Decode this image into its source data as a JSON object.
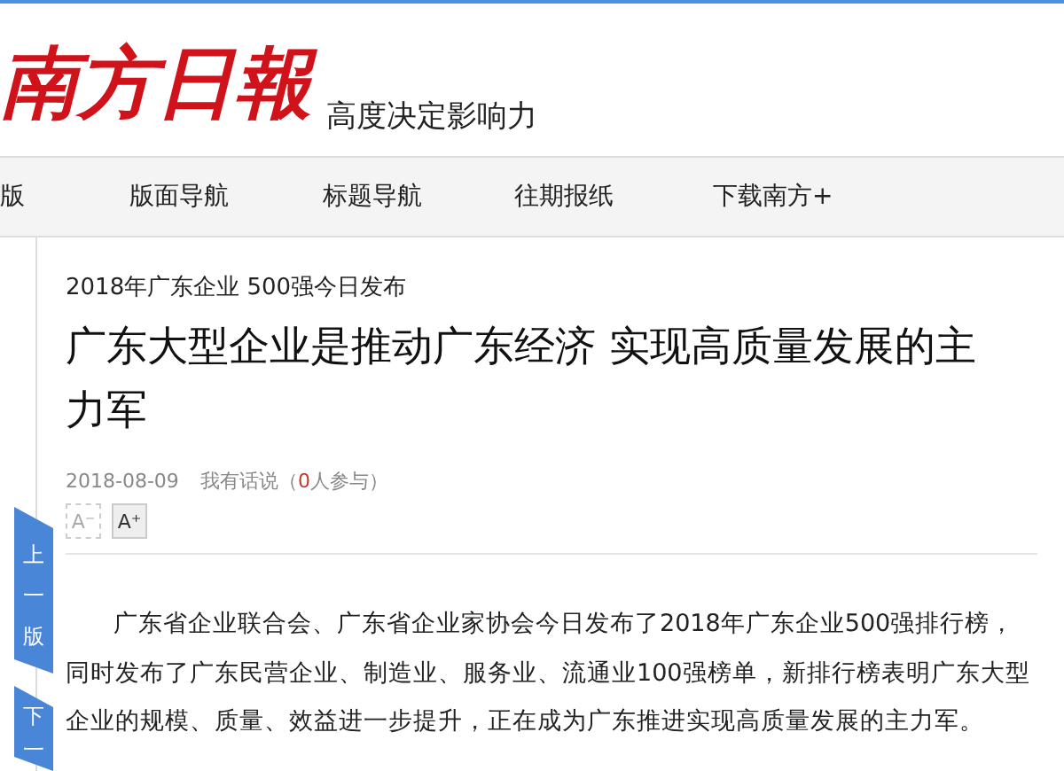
{
  "header": {
    "logo": "南方日報",
    "slogan": "高度决定影响力"
  },
  "nav": [
    {
      "label": "版"
    },
    {
      "label": "版面导航"
    },
    {
      "label": "标题导航"
    },
    {
      "label": "往期报纸"
    },
    {
      "label": "下载南方+"
    }
  ],
  "side_tabs": [
    {
      "label": "上一版"
    },
    {
      "label": "下一"
    }
  ],
  "article": {
    "kicker": "2018年广东企业 500强今日发布",
    "title": "广东大型企业是推动广东经济 实现高质量发展的主力军",
    "date": "2018-08-09",
    "comment_label": "我有话说（",
    "comment_count": "0",
    "comment_suffix": "人参与）",
    "font_buttons": [
      {
        "label": "A⁻",
        "disabled": true
      },
      {
        "label": "A⁺",
        "disabled": false
      }
    ],
    "body": "广东省企业联合会、广东省企业家协会今日发布了2018年广东企业500强排行榜，同时发布了广东民营企业、制造业、服务业、流通业100强榜单，新排行榜表明广东大型企业的规模、质量、效益进一步提升，正在成为广东推进实现高质量发展的主力军。"
  }
}
